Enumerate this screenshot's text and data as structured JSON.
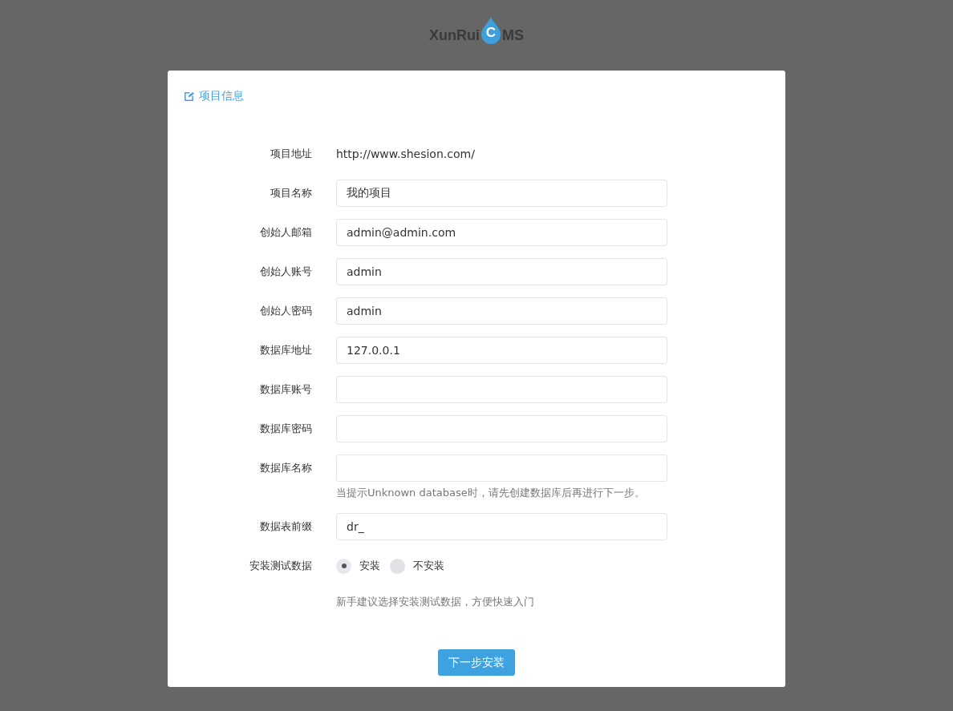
{
  "logo": {
    "before": "XunRui",
    "mark": "C",
    "after": "MS"
  },
  "panel": {
    "title": "项目信息"
  },
  "fields": [
    {
      "kind": "text",
      "label": "项目地址",
      "value": "http://www.shesion.com/"
    },
    {
      "kind": "input",
      "label": "项目名称",
      "value": "我的项目"
    },
    {
      "kind": "input",
      "label": "创始人邮箱",
      "value": "admin@admin.com"
    },
    {
      "kind": "input",
      "label": "创始人账号",
      "value": "admin"
    },
    {
      "kind": "input",
      "label": "创始人密码",
      "value": "admin"
    },
    {
      "kind": "input",
      "label": "数据库地址",
      "value": "127.0.0.1"
    },
    {
      "kind": "input",
      "label": "数据库账号"
    },
    {
      "kind": "input",
      "label": "数据库密码"
    },
    {
      "kind": "input",
      "label": "数据库名称",
      "hint": "当提示Unknown database时，请先创建数据库后再进行下一步。"
    },
    {
      "kind": "input",
      "label": "数据表前缀",
      "value": "dr_"
    },
    {
      "kind": "radio",
      "label": "安装测试数据",
      "options": [
        {
          "label": "安装",
          "selected": true
        },
        {
          "label": "不安装",
          "selected": false
        }
      ],
      "hint": "新手建议选择安装测试数据，方便快速入门"
    }
  ],
  "submit": "下一步安装"
}
